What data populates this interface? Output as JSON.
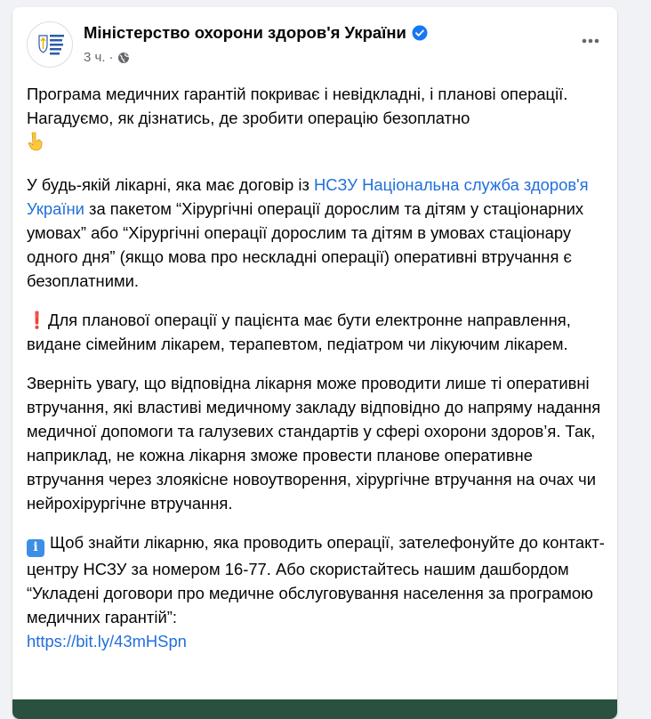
{
  "post": {
    "author": "Міністерство охорони здоров'я України",
    "time": "3 ч.",
    "dot": "·",
    "paragraphs": {
      "p1": "Програма медичних гарантій покриває і невідкладні, і планові операції. Нагадуємо, як дізнатись, де зробити операцію безоплатно",
      "p2_before": "У будь-якій лікарні, яка має договір із ",
      "p2_link": "НСЗУ Національна служба здоров'я України",
      "p2_after": " за пакетом “Хірургічні операції дорослим та дітям у стаціонарних умовах” або “Хірургічні операції дорослим та дітям в умовах стаціонару одного дня” (якщо мова про нескладні операції) оперативні втручання є безоплатними.",
      "p3_icon": "❗",
      "p3": "Для планової операції у пацієнта має бути електронне направлення, видане сімейним лікарем, терапевтом, педіатром чи лікуючим лікарем.",
      "p4": "Зверніть увагу, що відповідна лікарня може проводити лише ті оперативні втручання, які властиві медичному закладу відповідно до напряму надання медичної допомоги та галузевих стандартів у сфері охорони здоров’я. Так, наприклад, не кожна лікарня зможе провести планове оперативне втручання через злоякісне новоутворення, хірургічне втручання на очах чи нейрохірургічне втручання.",
      "p5_icon": "i",
      "p5": "Щоб знайти лікарню, яка проводить операції, зателефонуйте до контакт-центру НСЗУ за номером 16-77. Або скористайтесь нашим дашбордом “Укладені договори про медичне обслуговування населення за програмою медичних гарантій”:",
      "p5_link": "https://bit.ly/43mHSpn"
    }
  },
  "icons": {
    "verified": "verified-badge-icon",
    "privacy": "globe-icon",
    "more": "more-options-icon",
    "point_down": "point-down-emoji-icon",
    "exclamation": "exclamation-emoji-icon",
    "info": "info-emoji-icon"
  },
  "colors": {
    "link": "#216fdb",
    "secondary_text": "#65676b",
    "verified": "#1877f2",
    "exclamation": "#e0245e",
    "info": "#3c8ee6",
    "image_strip": "#2a5040"
  }
}
